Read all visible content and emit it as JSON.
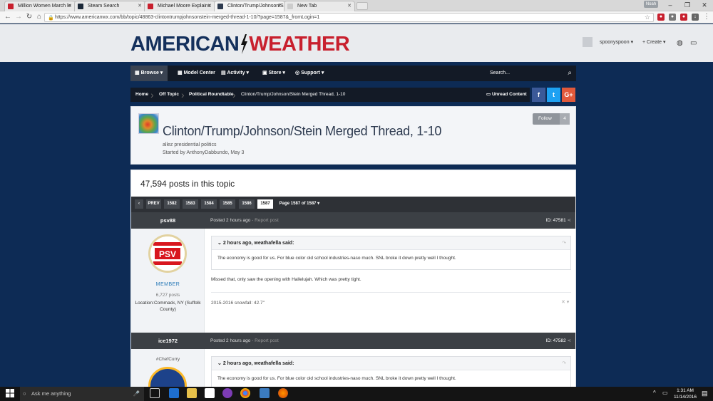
{
  "browser": {
    "tabs": [
      {
        "label": "Million Women March le",
        "color": "#c8202e",
        "active": false
      },
      {
        "label": "Steam Search",
        "color": "#1b2838",
        "active": false
      },
      {
        "label": "Michael Moore Explains",
        "color": "#c8202e",
        "active": false
      },
      {
        "label": "Clinton/Trump/Johnson/S",
        "color": "#2d3a4f",
        "active": true
      },
      {
        "label": "New Tab",
        "color": "#d8d8d8",
        "active": false
      }
    ],
    "profile_label": "Noah",
    "url": "https://www.americanwx.com/bb/topic/48863-clintontrumpjohnsonstein-merged-thread-1-10/?page=1587&_fromLogin=1"
  },
  "site": {
    "logo_part1": "AMERICAN",
    "logo_part2": "WEATHER",
    "username": "spoonyspoon",
    "create_label": "Create"
  },
  "nav": {
    "items": [
      "Browse",
      "Model Center",
      "Activity",
      "Store",
      "Support"
    ],
    "search_placeholder": "Search..."
  },
  "breadcrumb": {
    "items": [
      "Home",
      "Off Topic",
      "Political Roundtable",
      "Clinton/Trump/Johnson/Stein Merged Thread, 1-10"
    ],
    "unread_label": "Unread Content"
  },
  "thread": {
    "title": "Clinton/Trump/Johnson/Stein Merged Thread, 1-10",
    "tagline": "allez presidential politics",
    "started_by_prefix": "Started by",
    "started_by_user": "AnthonyDabbundo",
    "started_on": "May 3",
    "follow_label": "Follow",
    "follow_count": "4"
  },
  "posts_count_label": "47,594 posts in this topic",
  "pager": {
    "prev_label": "PREV",
    "pages": [
      "1582",
      "1583",
      "1584",
      "1585",
      "1586",
      "1587"
    ],
    "current": "1587",
    "page_of": "Page 1587 of 1587"
  },
  "posts": [
    {
      "author": "psv88",
      "posted": "Posted 2 hours ago",
      "report": "Report post",
      "id": "ID: 47581",
      "rank": "MEMBER",
      "post_count": "6,727 posts",
      "location_label": "Location:",
      "location": "Commack, NY (Suffolk County)",
      "quote_author": "2 hours ago, weathafella said:",
      "quote_text": "The economy is good for us.   For blue color old school industries-naso much.    SNL broke it down pretty well I thought.",
      "body": "Missed that, only saw the opening with Hallelujah. Which was pretty tight.",
      "signature": "2015-2016 snowfall: 42.7\""
    },
    {
      "author": "ice1972",
      "posted": "Posted 2 hours ago",
      "report": "Report post",
      "id": "ID: 47582",
      "title": "#ChefCurry",
      "quote_author": "2 hours ago, weathafella said:",
      "quote_text": "The economy is good for us.   For blue color old school industries-naso much.    SNL broke it down pretty well I thought."
    }
  ],
  "taskbar": {
    "search_placeholder": "Ask me anything",
    "time": "1:31 AM",
    "date": "11/14/2016"
  }
}
